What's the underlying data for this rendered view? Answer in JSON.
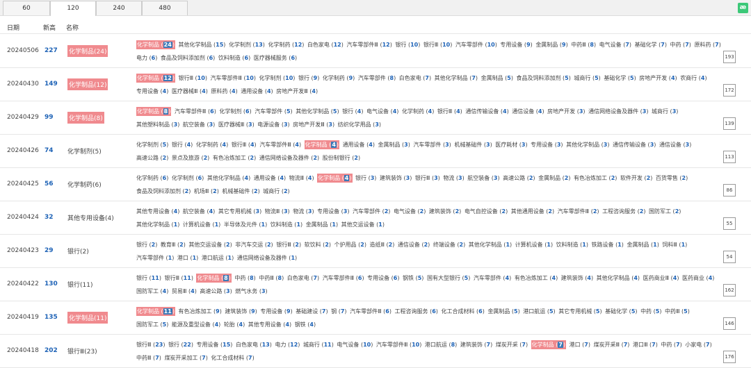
{
  "tabs": [
    "60",
    "120",
    "240",
    "480"
  ],
  "active_tab": 1,
  "logo": "æ",
  "headers": {
    "date": "日期",
    "new_high": "新高",
    "name": "名称"
  },
  "rows": [
    {
      "date": "20240506",
      "new_high": "227",
      "name": "化学制品(24)",
      "name_hl": true,
      "count": "193",
      "items": [
        [
          "化学制品",
          "24",
          true
        ],
        [
          "其他化学制品",
          "15"
        ],
        [
          "化学制剂",
          "13"
        ],
        [
          "化学制药",
          "12"
        ],
        [
          "白色家电",
          "12"
        ],
        [
          "汽车零部件Ⅲ",
          "12"
        ],
        [
          "银行",
          "10"
        ],
        [
          "银行Ⅲ",
          "10"
        ],
        [
          "汽车零部件",
          "10"
        ],
        [
          "专用设备",
          "9"
        ],
        [
          "金属制品",
          "9"
        ],
        [
          "中药Ⅲ",
          "8"
        ],
        [
          "电气设备",
          "7"
        ],
        [
          "基础化学",
          "7"
        ],
        [
          "中药",
          "7"
        ],
        [
          "原料药",
          "7"
        ],
        [
          "电力",
          "6"
        ],
        [
          "食品及饲料添加剂",
          "6"
        ],
        [
          "饮料制造",
          "6"
        ],
        [
          "医疗器械服务",
          "6"
        ]
      ]
    },
    {
      "date": "20240430",
      "new_high": "149",
      "name": "化学制品(12)",
      "name_hl": true,
      "count": "172",
      "items": [
        [
          "化学制品",
          "12",
          true
        ],
        [
          "银行Ⅲ",
          "10"
        ],
        [
          "汽车零部件Ⅲ",
          "10"
        ],
        [
          "化学制剂",
          "10"
        ],
        [
          "银行",
          "9"
        ],
        [
          "化学制药",
          "9"
        ],
        [
          "汽车零部件",
          "8"
        ],
        [
          "白色家电",
          "7"
        ],
        [
          "其他化学制品",
          "7"
        ],
        [
          "金属制品",
          "5"
        ],
        [
          "食品及饲料添加剂",
          "5"
        ],
        [
          "城商行",
          "5"
        ],
        [
          "基础化学",
          "5"
        ],
        [
          "房地产开发",
          "4"
        ],
        [
          "农商行",
          "4"
        ],
        [
          "专用设备",
          "4"
        ],
        [
          "医疗器械Ⅲ",
          "4"
        ],
        [
          "原料药",
          "4"
        ],
        [
          "通用设备",
          "4"
        ],
        [
          "房地产开发Ⅲ",
          "4"
        ]
      ]
    },
    {
      "date": "20240429",
      "new_high": "99",
      "name": "化学制品(8)",
      "name_hl": true,
      "count": "139",
      "items": [
        [
          "化学制品",
          "8",
          true
        ],
        [
          "汽车零部件Ⅲ",
          "6"
        ],
        [
          "化学制剂",
          "6"
        ],
        [
          "汽车零部件",
          "5"
        ],
        [
          "其他化学制品",
          "5"
        ],
        [
          "银行",
          "4"
        ],
        [
          "电气设备",
          "4"
        ],
        [
          "化学制药",
          "4"
        ],
        [
          "银行Ⅲ",
          "4"
        ],
        [
          "通信传输设备",
          "4"
        ],
        [
          "通信设备",
          "4"
        ],
        [
          "房地产开发",
          "3"
        ],
        [
          "通信网络设备及器件",
          "3"
        ],
        [
          "城商行",
          "3"
        ],
        [
          "其他塑料制品",
          "3"
        ],
        [
          "航空装备",
          "3"
        ],
        [
          "医疗器械Ⅲ",
          "3"
        ],
        [
          "电源设备",
          "3"
        ],
        [
          "房地产开发Ⅲ",
          "3"
        ],
        [
          "纺织化学用品",
          "3"
        ]
      ]
    },
    {
      "date": "20240426",
      "new_high": "74",
      "name": "化学制剂(5)",
      "name_hl": false,
      "count": "113",
      "items": [
        [
          "化学制剂",
          "5"
        ],
        [
          "银行",
          "4"
        ],
        [
          "化学制药",
          "4"
        ],
        [
          "银行Ⅲ",
          "4"
        ],
        [
          "汽车零部件Ⅲ",
          "4"
        ],
        [
          "化学制品",
          "4",
          true
        ],
        [
          "通用设备",
          "4"
        ],
        [
          "金属制品",
          "3"
        ],
        [
          "汽车零部件",
          "3"
        ],
        [
          "机械基础件",
          "3"
        ],
        [
          "医疗耗材",
          "3"
        ],
        [
          "专用设备",
          "3"
        ],
        [
          "其他化学制品",
          "3"
        ],
        [
          "通信传输设备",
          "3"
        ],
        [
          "通信设备",
          "3"
        ],
        [
          "高速公路",
          "2"
        ],
        [
          "景点及旅游",
          "2"
        ],
        [
          "有色冶炼加工",
          "2"
        ],
        [
          "通信网络设备及器件",
          "2"
        ],
        [
          "股份制银行",
          "2"
        ]
      ]
    },
    {
      "date": "20240425",
      "new_high": "56",
      "name": "化学制药(6)",
      "name_hl": false,
      "count": "86",
      "items": [
        [
          "化学制药",
          "6"
        ],
        [
          "化学制剂",
          "6"
        ],
        [
          "其他化学制品",
          "4"
        ],
        [
          "通用设备",
          "4"
        ],
        [
          "物流Ⅲ",
          "4"
        ],
        [
          "化学制品",
          "4",
          true
        ],
        [
          "银行",
          "3"
        ],
        [
          "建筑装饰",
          "3"
        ],
        [
          "银行Ⅲ",
          "3"
        ],
        [
          "物流",
          "3"
        ],
        [
          "航空装备",
          "3"
        ],
        [
          "高速公路",
          "2"
        ],
        [
          "金属制品",
          "2"
        ],
        [
          "有色冶炼加工",
          "2"
        ],
        [
          "软件开发",
          "2"
        ],
        [
          "百货零售",
          "2"
        ],
        [
          "食品及饲料添加剂",
          "2"
        ],
        [
          "机场Ⅲ",
          "2"
        ],
        [
          "机械基础件",
          "2"
        ],
        [
          "城商行",
          "2"
        ]
      ]
    },
    {
      "date": "20240424",
      "new_high": "32",
      "name": "其他专用设备(4)",
      "name_hl": false,
      "count": "55",
      "items": [
        [
          "其他专用设备",
          "4"
        ],
        [
          "航空装备",
          "4"
        ],
        [
          "其它专用机械",
          "3"
        ],
        [
          "物流Ⅲ",
          "3"
        ],
        [
          "物流",
          "3"
        ],
        [
          "专用设备",
          "3"
        ],
        [
          "汽车零部件",
          "2"
        ],
        [
          "电气设备",
          "2"
        ],
        [
          "建筑装饰",
          "2"
        ],
        [
          "电气自控设备",
          "2"
        ],
        [
          "其他通用设备",
          "2"
        ],
        [
          "汽车零部件Ⅲ",
          "2"
        ],
        [
          "工程咨询服务",
          "2"
        ],
        [
          "国防军工",
          "2"
        ],
        [
          "其他化学制品",
          "1"
        ],
        [
          "计算机设备",
          "1"
        ],
        [
          "半导体及元件",
          "1"
        ],
        [
          "饮料制造",
          "1"
        ],
        [
          "金属制品",
          "1"
        ],
        [
          "其他交运设备",
          "1"
        ]
      ]
    },
    {
      "date": "20240423",
      "new_high": "29",
      "name": "银行(2)",
      "name_hl": false,
      "count": "54",
      "items": [
        [
          "银行",
          "2"
        ],
        [
          "教育Ⅲ",
          "2"
        ],
        [
          "其他交运设备",
          "2"
        ],
        [
          "非汽车交运",
          "2"
        ],
        [
          "银行Ⅲ",
          "2"
        ],
        [
          "软饮料",
          "2"
        ],
        [
          "个护用品",
          "2"
        ],
        [
          "造纸Ⅲ",
          "2"
        ],
        [
          "通信设备",
          "2"
        ],
        [
          "终端设备",
          "2"
        ],
        [
          "其他化学制品",
          "1"
        ],
        [
          "计算机设备",
          "1"
        ],
        [
          "饮料制造",
          "1"
        ],
        [
          "铁路设备",
          "1"
        ],
        [
          "金属制品",
          "1"
        ],
        [
          "饲料Ⅲ",
          "1"
        ],
        [
          "汽车零部件",
          "1"
        ],
        [
          "港口",
          "1"
        ],
        [
          "港口航运",
          "1"
        ],
        [
          "通信网络设备及器件",
          "1"
        ]
      ]
    },
    {
      "date": "20240422",
      "new_high": "130",
      "name": "银行(11)",
      "name_hl": false,
      "count": "162",
      "items": [
        [
          "银行",
          "11"
        ],
        [
          "银行Ⅲ",
          "11"
        ],
        [
          "化学制品",
          "8",
          true
        ],
        [
          "中药",
          "8"
        ],
        [
          "中药Ⅲ",
          "8"
        ],
        [
          "白色家电",
          "7"
        ],
        [
          "汽车零部件Ⅲ",
          "6"
        ],
        [
          "专用设备",
          "6"
        ],
        [
          "钢铁",
          "5"
        ],
        [
          "国有大型银行",
          "5"
        ],
        [
          "汽车零部件",
          "4"
        ],
        [
          "有色冶炼加工",
          "4"
        ],
        [
          "建筑装饰",
          "4"
        ],
        [
          "其他化学制品",
          "4"
        ],
        [
          "医药商业Ⅲ",
          "4"
        ],
        [
          "医药商业",
          "4"
        ],
        [
          "国防军工",
          "4"
        ],
        [
          "贸易Ⅲ",
          "4"
        ],
        [
          "高速公路",
          "3"
        ],
        [
          "燃气水务",
          "3"
        ]
      ]
    },
    {
      "date": "20240419",
      "new_high": "135",
      "name": "化学制品(11)",
      "name_hl": true,
      "count": "146",
      "items": [
        [
          "化学制品",
          "11",
          true
        ],
        [
          "有色冶炼加工",
          "9"
        ],
        [
          "建筑装饰",
          "9"
        ],
        [
          "专用设备",
          "9"
        ],
        [
          "基础建设",
          "7"
        ],
        [
          "钢",
          "7"
        ],
        [
          "汽车零部件Ⅲ",
          "6"
        ],
        [
          "工程咨询服务",
          "6"
        ],
        [
          "化工合成材料",
          "6"
        ],
        [
          "金属制品",
          "5"
        ],
        [
          "港口航运",
          "5"
        ],
        [
          "其它专用机械",
          "5"
        ],
        [
          "基础化学",
          "5"
        ],
        [
          "中药",
          "5"
        ],
        [
          "中药Ⅲ",
          "5"
        ],
        [
          "国防军工",
          "5"
        ],
        [
          "能源及重型设备",
          "4"
        ],
        [
          "轮胎",
          "4"
        ],
        [
          "其他专用设备",
          "4"
        ],
        [
          "钢铁",
          "4"
        ]
      ]
    },
    {
      "date": "20240418",
      "new_high": "202",
      "name": "银行Ⅲ(23)",
      "name_hl": false,
      "count": "176",
      "items": [
        [
          "银行Ⅲ",
          "23"
        ],
        [
          "银行",
          "22"
        ],
        [
          "专用设备",
          "15"
        ],
        [
          "白色家电",
          "13"
        ],
        [
          "电力",
          "12"
        ],
        [
          "城商行",
          "11"
        ],
        [
          "电气设备",
          "10"
        ],
        [
          "汽车零部件Ⅲ",
          "10"
        ],
        [
          "港口航运",
          "8"
        ],
        [
          "建筑装饰",
          "7"
        ],
        [
          "煤炭开采",
          "7"
        ],
        [
          "化学制品",
          "7",
          true
        ],
        [
          "港口",
          "7"
        ],
        [
          "煤炭开采Ⅲ",
          "7"
        ],
        [
          "港口Ⅲ",
          "7"
        ],
        [
          "中药",
          "7"
        ],
        [
          "小家电",
          "7"
        ],
        [
          "中药Ⅲ",
          "7"
        ],
        [
          "煤炭开采加工",
          "7"
        ],
        [
          "化工合成材料",
          "7"
        ]
      ]
    }
  ]
}
